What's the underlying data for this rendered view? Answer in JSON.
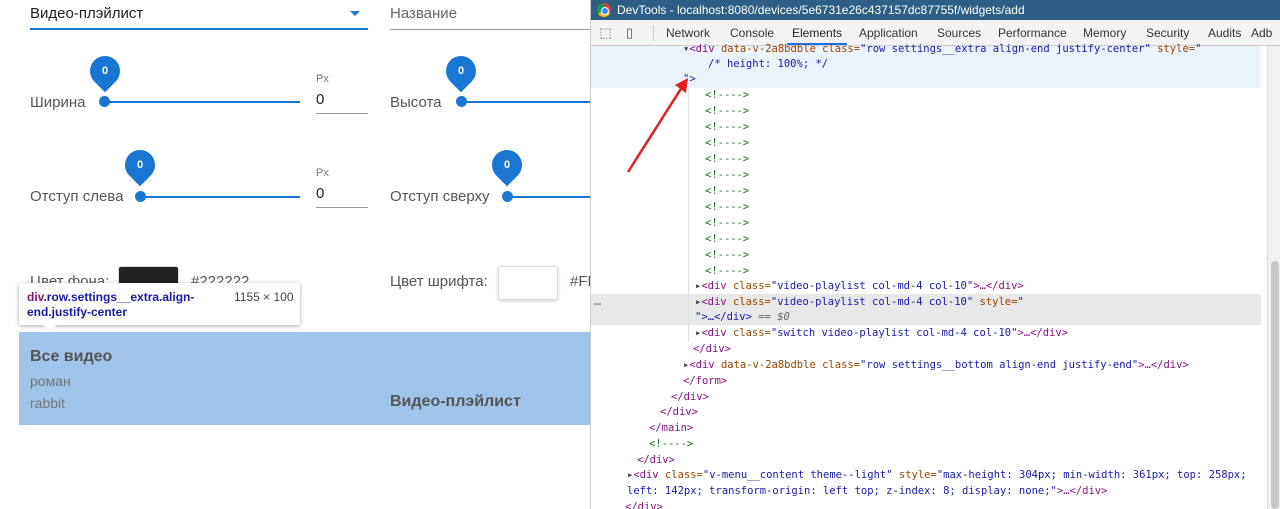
{
  "app": {
    "select_value": "Видео-плэйлист",
    "name_placeholder": "Название",
    "sliders": [
      {
        "label": "Ширина",
        "value": "0",
        "unit": "Px",
        "input": "0"
      },
      {
        "label": "Высота",
        "value": "0"
      },
      {
        "label": "Отступ слева",
        "value": "0",
        "unit": "Px",
        "input": "0"
      },
      {
        "label": "Отступ сверху",
        "value": "0"
      }
    ],
    "bg_color_label": "Цвет фона:",
    "bg_color_hex": "#222222",
    "bg_color": "#222222",
    "font_color_label": "Цвет шрифта:",
    "font_color_hex": "#FF",
    "tooltip": {
      "selector_tag": "div",
      "selector_rest": ".row.settings__extra.align-end.justify-center",
      "dims": "1155 × 100"
    },
    "all_videos_title": "Все видео",
    "items": [
      "роман",
      "rabbit"
    ],
    "playlist_title": "Видео-плэйлист",
    "accent_color": "#1976d2",
    "highlight_color": "#a0c4e8"
  },
  "devtools": {
    "title": "DevTools - localhost:8080/devices/5e6731e26c437157dc87755f/widgets/add",
    "tabs": [
      "Network",
      "Console",
      "Elements",
      "Application",
      "Sources",
      "Performance",
      "Memory",
      "Security",
      "Audits",
      "Adb"
    ],
    "active_tab": "Elements",
    "code": {
      "l1_tag": "<div",
      "l1_attr1": " data-v-2a8bdble",
      "l1_val1": "",
      "l1_attr2": " class=",
      "l1_val2": "\"row settings__extra align-end justify-center\"",
      "l1_attr3": " style=",
      "l1_val3": "\"",
      "l2": "/* height: 100%; */",
      "l3": "\">",
      "comment": "<!---->",
      "vp1_open": "<div",
      "vp1_attr": " class=",
      "vp1_val": "\"video-playlist col-md-4 col-10\"",
      "vp1_close": ">…</div>",
      "vp2_attr_style": " style=",
      "vp2_style_val": "\"",
      "vp2_l2a": "\">…</div>",
      "vp2_eq": " == $0",
      "vp3_val": "\"switch video-playlist col-md-4 col-10\"",
      "div_close": "</div>",
      "bottom_val": "\"row settings__bottom align-end justify-end\"",
      "form_close": "</form>",
      "main_close": "</main>",
      "menu_attr1": " class=",
      "menu_val1": "\"v-menu__content theme--light\"",
      "menu_attr2": " style=",
      "menu_val2": "\"max-height: 304px; min-width: 361px; top: 258px;",
      "menu_val3": "left: 142px; transform-origin: left top; z-index: 8; display: none;\"",
      "dots": "…"
    }
  }
}
